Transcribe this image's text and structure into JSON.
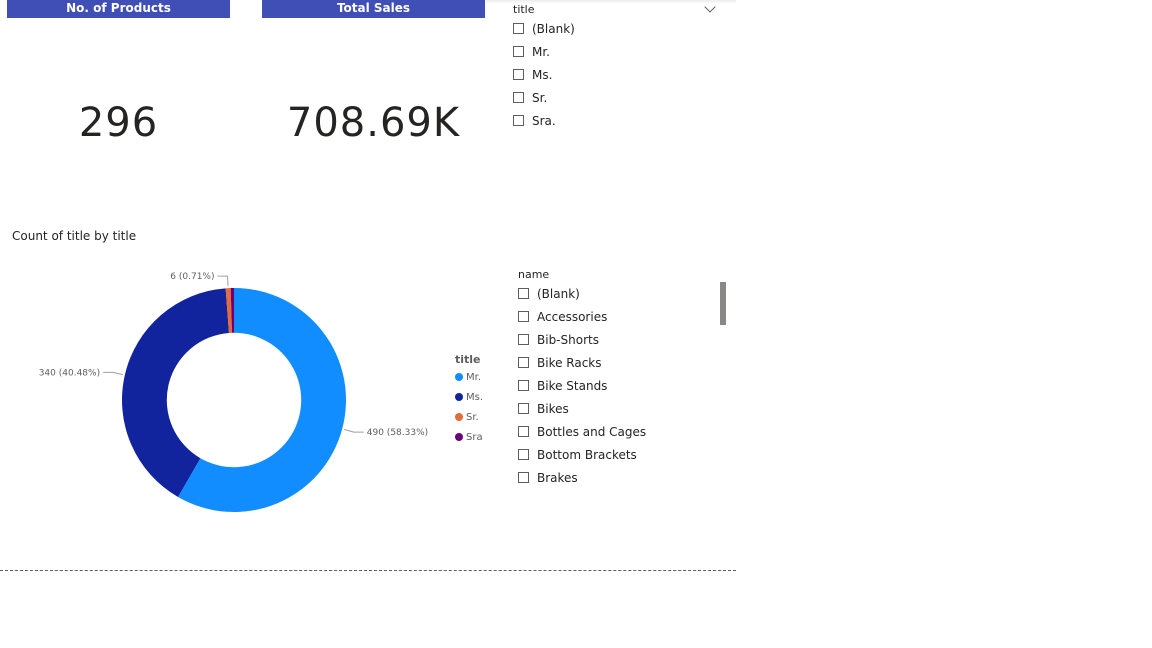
{
  "kpis": {
    "products": {
      "label": "No. of Products",
      "value": "296"
    },
    "sales": {
      "label": "Total Sales",
      "value": "708.69K"
    }
  },
  "title_slicer": {
    "header": "title",
    "items": [
      "(Blank)",
      "Mr.",
      "Ms.",
      "Sr.",
      "Sra."
    ]
  },
  "name_slicer": {
    "header": "name",
    "items": [
      "(Blank)",
      "Accessories",
      "Bib-Shorts",
      "Bike Racks",
      "Bike Stands",
      "Bikes",
      "Bottles and Cages",
      "Bottom Brackets",
      "Brakes"
    ]
  },
  "colors": {
    "kpi_header": "#3f4fb5",
    "mr": "#118dff",
    "ms": "#12239e",
    "sr": "#e66c37",
    "sra": "#6b007b"
  },
  "chart_data": {
    "type": "pie",
    "title": "Count of title by title",
    "legend_title": "title",
    "legend_position": "right",
    "inner_radius_ratio": 0.6,
    "categories": [
      "Mr.",
      "Ms.",
      "Sr.",
      "Sra."
    ],
    "values": [
      490,
      340,
      6,
      4
    ],
    "slice_colors": [
      "#118dff",
      "#12239e",
      "#e66c37",
      "#6b007b"
    ],
    "data_labels": [
      "490 (58.33%)",
      "340 (40.48%)",
      "6 (0.71%)",
      ""
    ],
    "legend_labels": [
      "Mr.",
      "Ms.",
      "Sr.",
      "Sra."
    ]
  }
}
